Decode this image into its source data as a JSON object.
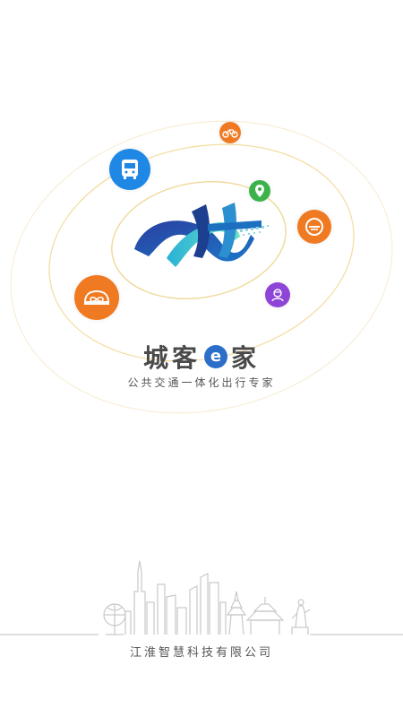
{
  "brand": {
    "name_part1": "城客",
    "e_letter": "e",
    "name_part2": "家",
    "slogan": "公共交通一体化出行专家"
  },
  "footer": {
    "company": "江淮智慧科技有限公司"
  },
  "icons": [
    {
      "name": "bicycle-icon",
      "color": "#f07a22"
    },
    {
      "name": "bus-icon",
      "color": "#1f88e5"
    },
    {
      "name": "location-pin-icon",
      "color": "#3cb34a"
    },
    {
      "name": "e-car-icon",
      "color": "#f07a22"
    },
    {
      "name": "driver-icon",
      "color": "#8e44d6"
    },
    {
      "name": "car-share-icon",
      "color": "#f07a22"
    }
  ],
  "colors": {
    "orbit": "#f3dca0",
    "logo_dark": "#1d3f8f",
    "logo_teal": "#38c2c6",
    "skyline": "#c9c9c9"
  }
}
